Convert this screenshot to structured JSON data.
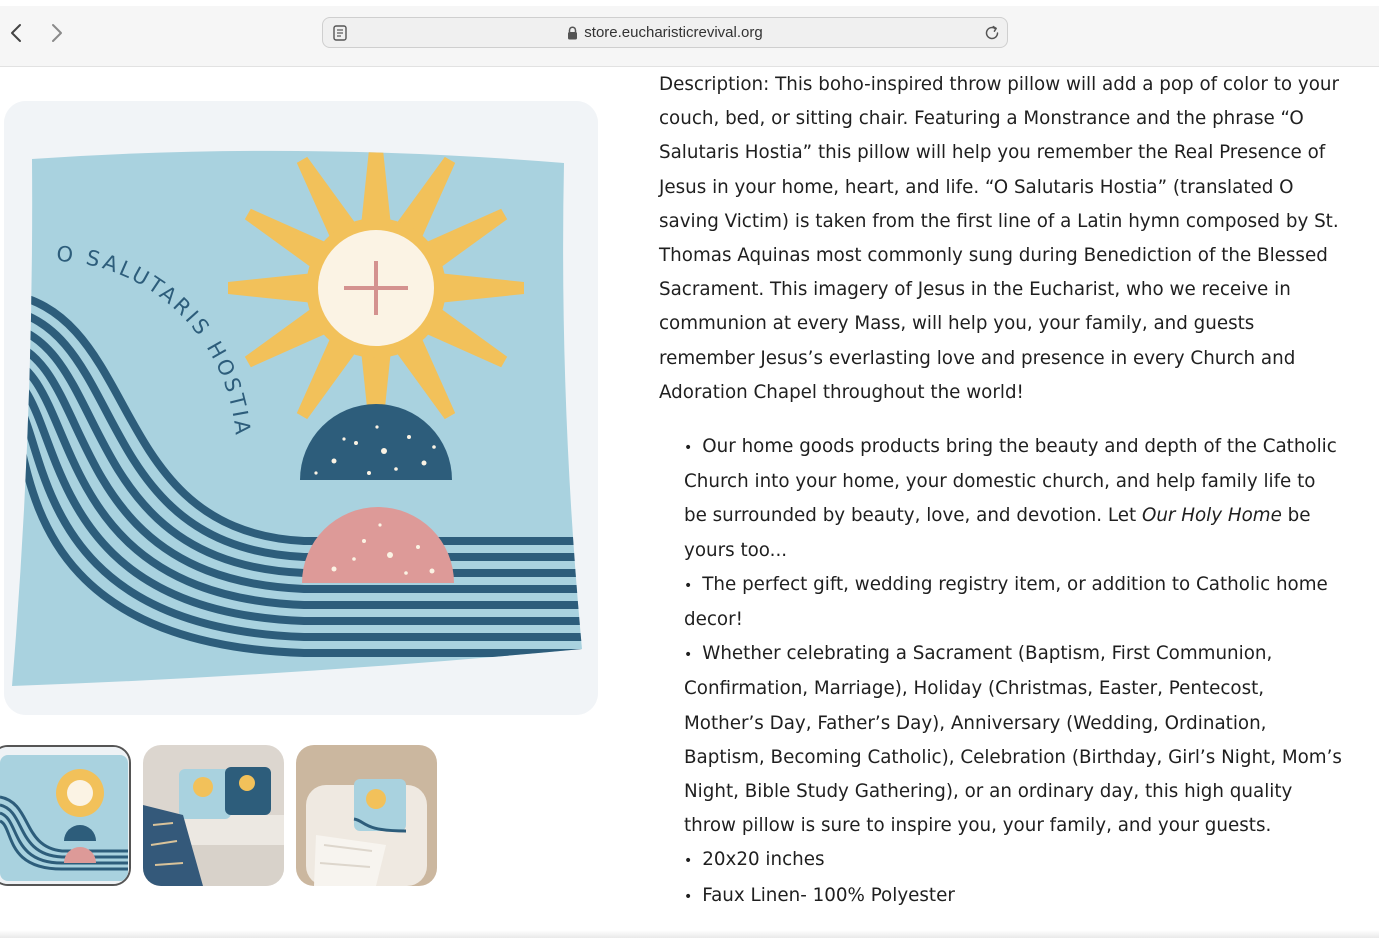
{
  "browser": {
    "url": "store.eucharisticrevival.org",
    "back_icon": "chevron-left-icon",
    "forward_icon": "chevron-right-icon",
    "reader_icon": "reader-mode-icon",
    "lock_icon": "lock-icon",
    "reload_icon": "reload-icon"
  },
  "product": {
    "pillow_text": "O SALUTARIS HOSTIA",
    "thumbnails": [
      "pillow-front",
      "pillow-on-sofa",
      "pillow-on-chair"
    ],
    "selected_thumbnail": 0,
    "colors": {
      "pillow": "#a9d2df",
      "stripes": "#2d5d7b",
      "sun": "#f2c15a",
      "host": "#fbf3e4",
      "pink": "#dd9a98"
    }
  },
  "description": {
    "paragraph": "Description: This boho-inspired throw pillow will add a pop of color to your couch, bed, or sitting chair. Featuring a Monstrance and the phrase “O Salutaris Hostia” this pillow will help you remember the Real Presence of Jesus in your home, heart, and life. “O Salutaris Hostia” (translated O saving Victim) is taken from the first line of a Latin hymn composed by St. Thomas Aquinas most commonly sung during Benediction of the Blessed Sacrament. This imagery of Jesus in the Eucharist, who we receive in communion at every Mass, will help you, your family, and guests remember Jesus’s everlasting love and presence in every Church and Adoration Chapel throughout the world!",
    "bullet1_before": "Our home goods products bring the beauty and depth of the Catholic Church into your home, your domestic church, and help family life to be surrounded by beauty, love, and devotion. Let ",
    "bullet1_italic": "Our Holy Home",
    "bullet1_after": " be yours too...",
    "bullet2": "The perfect gift, wedding registry item, or addition to Catholic home decor!",
    "bullet3": "Whether celebrating a Sacrament (Baptism, First Communion, Confirmation, Marriage), Holiday (Christmas, Easter, Pentecost, Mother’s Day, Father’s Day), Anniversary (Wedding, Ordination, Baptism, Becoming Catholic), Celebration (Birthday, Girl’s Night, Mom’s Night, Bible Study Gathering), or an ordinary day, this high quality throw pillow is sure to inspire you, your family, and your guests.",
    "bullet4": "20x20 inches",
    "bullet5": "Faux Linen- 100% Polyester"
  }
}
